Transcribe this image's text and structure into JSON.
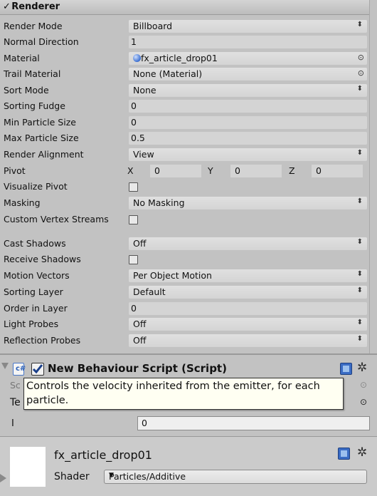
{
  "renderer": {
    "title": "Renderer",
    "rows": [
      {
        "label": "Render Mode",
        "value": "Billboard",
        "kind": "dropdown"
      },
      {
        "label": "Normal Direction",
        "value": "1",
        "kind": "number"
      },
      {
        "label": "Material",
        "value": "fx_article_drop01",
        "kind": "object"
      },
      {
        "label": "Trail Material",
        "value": "None (Material)",
        "kind": "object"
      },
      {
        "label": "Sort Mode",
        "value": "None",
        "kind": "dropdown"
      },
      {
        "label": "Sorting Fudge",
        "value": "0",
        "kind": "number"
      },
      {
        "label": "Min Particle Size",
        "value": "0",
        "kind": "number"
      },
      {
        "label": "Max Particle Size",
        "value": "0.5",
        "kind": "number"
      },
      {
        "label": "Render Alignment",
        "value": "View",
        "kind": "dropdown"
      },
      {
        "label": "Pivot",
        "kind": "vector",
        "x_label": "X",
        "x": "0",
        "y_label": "Y",
        "y": "0",
        "z_label": "Z",
        "z": "0"
      },
      {
        "label": "Visualize Pivot",
        "kind": "checkbox",
        "checked": false
      },
      {
        "label": "Masking",
        "value": "No Masking",
        "kind": "dropdown"
      },
      {
        "label": "Custom Vertex Streams",
        "kind": "checkbox",
        "checked": false
      },
      {
        "label": "Cast Shadows",
        "value": "Off",
        "kind": "dropdown"
      },
      {
        "label": "Receive Shadows",
        "kind": "checkbox",
        "checked": false
      },
      {
        "label": "Motion Vectors",
        "value": "Per Object Motion",
        "kind": "dropdown"
      },
      {
        "label": "Sorting Layer",
        "value": "Default",
        "kind": "dropdown"
      },
      {
        "label": "Order in Layer",
        "value": "0",
        "kind": "number"
      },
      {
        "label": "Light Probes",
        "value": "Off",
        "kind": "dropdown"
      },
      {
        "label": "Reflection Probes",
        "value": "Off",
        "kind": "dropdown"
      }
    ]
  },
  "script": {
    "title": "New Behaviour Script (Script)",
    "row1_label": "Sc",
    "row2_label": "Te",
    "row3_label": "I",
    "row3_value": "0",
    "tooltip": "Controls the velocity inherited from the emitter, for each particle."
  },
  "material": {
    "name": "fx_article_drop01",
    "shader_label": "Shader",
    "shader_value": "Particles/Additive"
  },
  "glyphs": {
    "check": "✓",
    "updown": "⬍",
    "target": "⊙",
    "dropdown": "▼",
    "gear": "✲"
  }
}
